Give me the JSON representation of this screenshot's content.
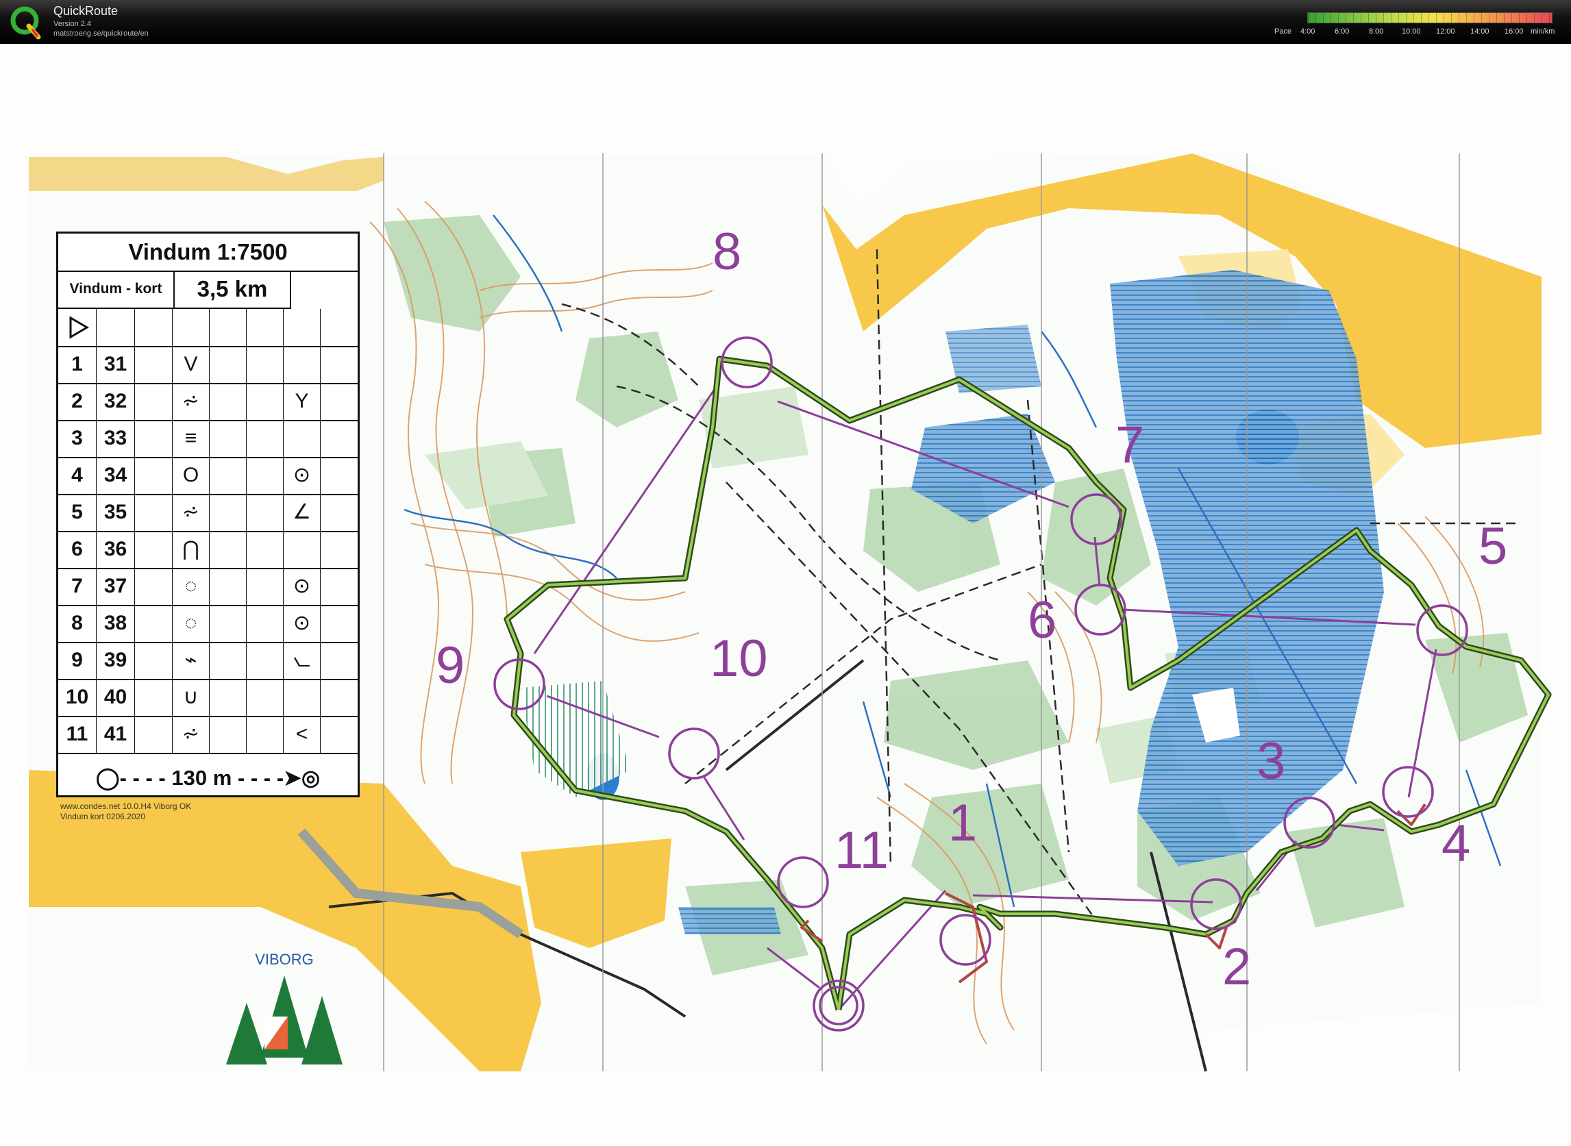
{
  "app": {
    "title": "QuickRoute",
    "version": "Version 2.4",
    "url": "matstroeng.se/quickroute/en"
  },
  "pace_legend": {
    "label": "Pace",
    "ticks": [
      "4:00",
      "6:00",
      "8:00",
      "10:00",
      "12:00",
      "14:00",
      "16:00"
    ],
    "unit": "min/km",
    "colors": [
      "#35a030",
      "#7cc443",
      "#c6dc4a",
      "#f3e24a",
      "#f6b04a",
      "#f27c4e",
      "#e84a55"
    ]
  },
  "map": {
    "title": "Vindum 1:7500",
    "event": "Vindum - kort",
    "length": "3,5 km",
    "finish_distance": "130 m",
    "credit_line1": "www.condes.net 10.0.H4 Viborg OK",
    "credit_line2": "Vindum kort 0206.2020",
    "club_name": "VIBORG",
    "course_color": "#8e3f9a",
    "route_color": "#3a6a2a",
    "controls": [
      {
        "number": "1",
        "code": "31",
        "symbol": "V",
        "extra": ""
      },
      {
        "number": "2",
        "code": "32",
        "symbol": "⩫",
        "extra": "Y"
      },
      {
        "number": "3",
        "code": "33",
        "symbol": "≡",
        "extra": ""
      },
      {
        "number": "4",
        "code": "34",
        "symbol": "O",
        "extra": "⊙"
      },
      {
        "number": "5",
        "code": "35",
        "symbol": "⩫",
        "extra": "∠"
      },
      {
        "number": "6",
        "code": "36",
        "symbol": "⋂",
        "extra": ""
      },
      {
        "number": "7",
        "code": "37",
        "symbol": "◌",
        "extra": "⊙"
      },
      {
        "number": "8",
        "code": "38",
        "symbol": "◌",
        "extra": "⊙"
      },
      {
        "number": "9",
        "code": "39",
        "symbol": "⌁",
        "extra": "⦦"
      },
      {
        "number": "10",
        "code": "40",
        "symbol": "∪",
        "extra": ""
      },
      {
        "number": "11",
        "code": "41",
        "symbol": "⩫",
        "extra": "<"
      }
    ],
    "control_labels": [
      "1",
      "2",
      "3",
      "4",
      "5",
      "6",
      "7",
      "8",
      "9",
      "10",
      "11"
    ]
  }
}
